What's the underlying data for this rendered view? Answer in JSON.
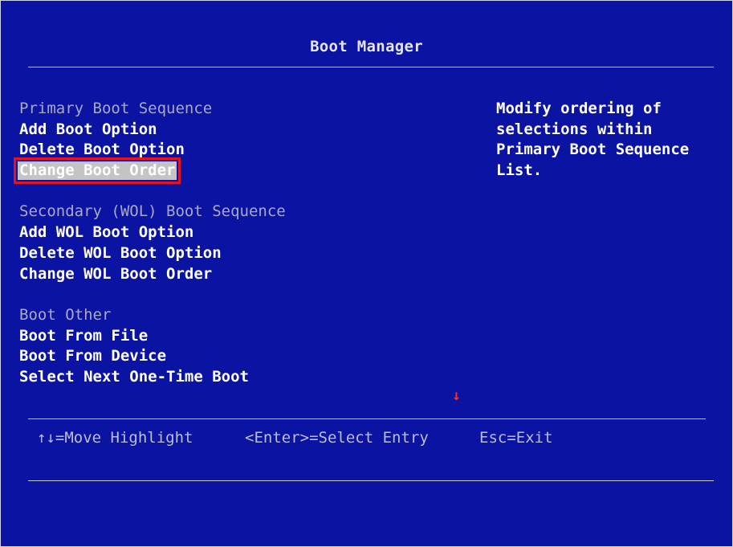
{
  "title": "Boot Manager",
  "menu": {
    "primary_header": "Primary Boot Sequence",
    "add_boot_option": "Add Boot Option",
    "delete_boot_option": "Delete Boot Option",
    "change_boot_order": "Change Boot Order",
    "secondary_header": "Secondary (WOL) Boot Sequence",
    "add_wol_boot_option": "Add WOL Boot Option",
    "delete_wol_boot_option": "Delete WOL Boot Option",
    "change_wol_boot_order": "Change WOL Boot Order",
    "other_header": "Boot Other",
    "boot_from_file": "Boot From File",
    "boot_from_device": "Boot From Device",
    "select_next_one_time_boot": "Select Next One-Time Boot"
  },
  "selected_item": "Change Boot Order",
  "help": {
    "text": "Modify ordering of\nselections within\nPrimary Boot Sequence\nList."
  },
  "scroll_indicator": "↓",
  "footer": {
    "move_highlight": "↑↓=Move Highlight",
    "select_entry": "<Enter>=Select Entry",
    "exit": "Esc=Exit"
  },
  "colors": {
    "background": "#0b13a3",
    "highlight": "#c4c4c4",
    "selection_frame": "#e5141c",
    "header_text": "#a9a9c4",
    "item_text": "#ffffff"
  }
}
